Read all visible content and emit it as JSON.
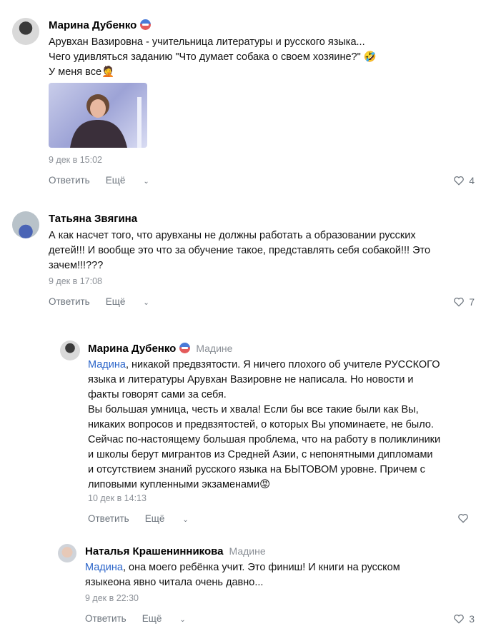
{
  "comments": [
    {
      "author": "Марина Дубенко",
      "text_lines": [
        "Арувхан Вазировна - учительница литературы и русского языка...",
        "Чего удивляться заданию \"Что думает собака о своем хозяине?\" 🤣",
        "У меня все🤦"
      ],
      "date": "9 дек в 15:02",
      "reply_label": "Ответить",
      "more_label": "Ещё",
      "likes": "4"
    },
    {
      "author": "Татьяна Звягина",
      "text_lines": [
        "А как насчет того, что арувханы не должны работать а образовании русских",
        "детей!!! И вообще это что за обучение такое, представлять себя собакой!!! Это",
        "зачем!!!???"
      ],
      "date": "9 дек в 17:08",
      "reply_label": "Ответить",
      "more_label": "Ещё",
      "likes": "7"
    },
    {
      "author": "Марина Дубенко",
      "reply_to": "Мадине",
      "mention": "Мадина",
      "text_first": ", никакой предвзятости. Я ничего плохого об учителе РУССКОГО",
      "text_lines": [
        "языка и литературы Арувхан Вазировне не написала. Но новости и",
        "факты говорят сами за себя.",
        "Вы большая умница, честь и хвала! Если бы все такие были как Вы,",
        "никаких вопросов и предвзятостей, о которых Вы упоминаете, не было.",
        "Сейчас по-настоящему большая проблема, что на работу в поликлиники",
        "и школы берут мигрантов из Средней Азии, с непонятными дипломами",
        "и отсутствием знаний русского языка на БЫТОВОМ уровне. Причем с",
        "липовыми купленными экзаменами😡"
      ],
      "date": "10 дек в 14:13",
      "reply_label": "Ответить",
      "more_label": "Ещё",
      "likes": ""
    },
    {
      "author": "Наталья Крашенинникова",
      "reply_to": "Мадине",
      "mention": "Мадина",
      "text_first": ", она моего ребёнка учит. Это финиш! И книги на русском",
      "text_lines": [
        "языкеона явно читала очень давно..."
      ],
      "date": "9 дек в 22:30",
      "reply_label": "Ответить",
      "more_label": "Ещё",
      "likes": "3"
    }
  ]
}
